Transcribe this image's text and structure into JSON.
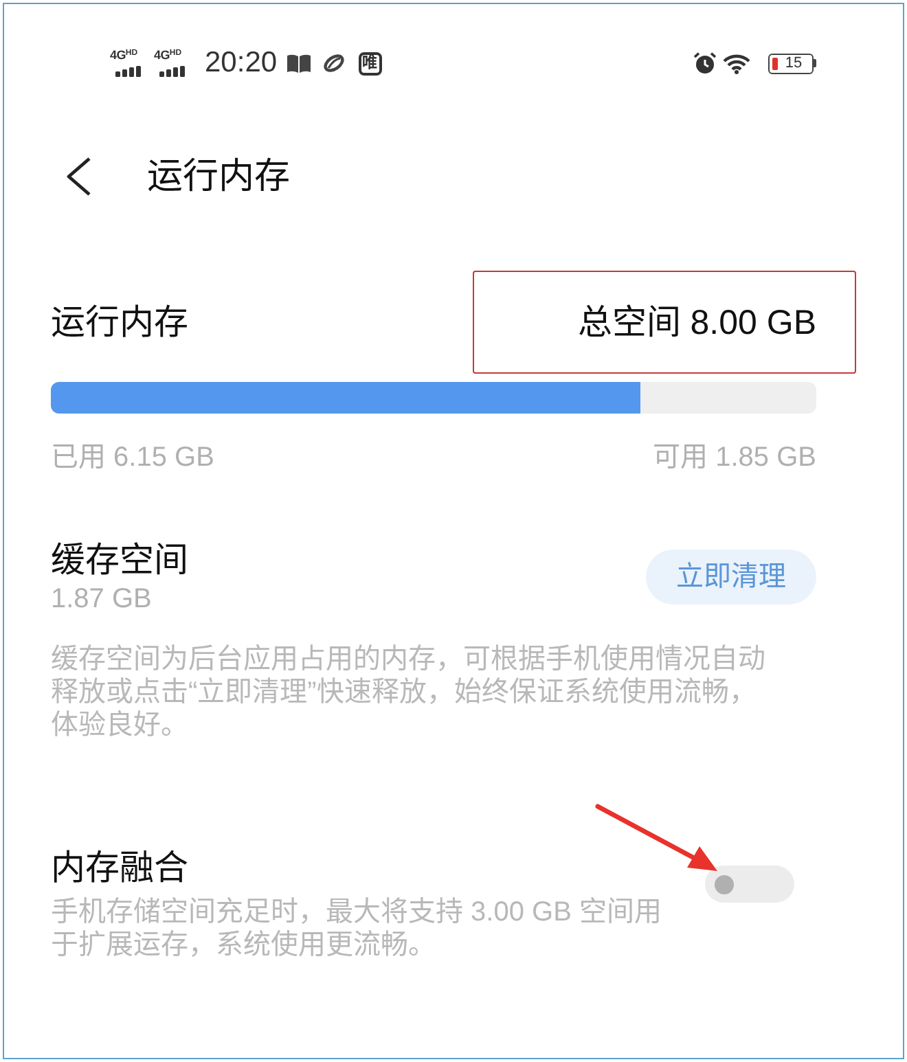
{
  "status_bar": {
    "signals": [
      {
        "network": "4G",
        "badge": "HD"
      },
      {
        "network": "4G",
        "badge": "HD"
      }
    ],
    "time": "20:20",
    "notification_badge": "唯",
    "battery": "15"
  },
  "header": {
    "title": "运行内存"
  },
  "memory": {
    "title": "运行内存",
    "total": "总空间 8.00 GB",
    "total_highlighted": true,
    "level": 0.77,
    "used": "已用 6.15 GB",
    "available": "可用 1.85 GB"
  },
  "cache": {
    "title": "缓存空间",
    "size": "1.87 GB",
    "button": "立即清理",
    "description": "缓存空间为后台应用占用的内存，可根据手机使用情况自动释放或点击“立即清理”快速释放，始终保证系统使用流畅，体验良好。"
  },
  "fusion": {
    "title": "内存融合",
    "description": "手机存储空间充足时，最大将支持 3.00 GB 空间用于扩展运存，系统使用更流畅。",
    "on": false,
    "arrow": true
  }
}
